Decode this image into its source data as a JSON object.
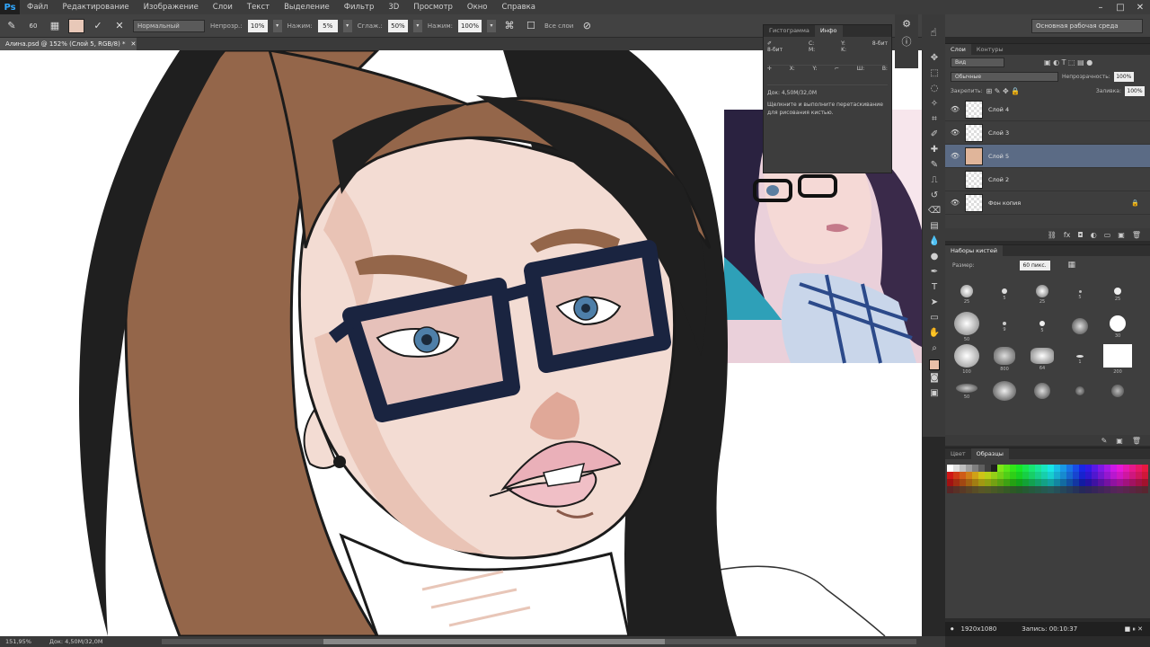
{
  "menubar": {
    "logo": "Ps",
    "items": [
      "Файл",
      "Редактирование",
      "Изображение",
      "Слои",
      "Текст",
      "Выделение",
      "Фильтр",
      "3D",
      "Просмотр",
      "Окно",
      "Справка"
    ],
    "minimize": "–",
    "maximize": "□",
    "close": "✕"
  },
  "options": {
    "brush_size": "60",
    "mode": "Нормальный",
    "opacity_label": "Непрозр.:",
    "opacity": "10%",
    "flow_label": "Нажим:",
    "flow": "5%",
    "smooth_label": "Сглаж.:",
    "smooth": "50%",
    "strength_label": "Нажим:",
    "strength": "100%",
    "sample_label": "Все слои",
    "workspace": "Основная рабочая среда"
  },
  "document": {
    "tab_title": "Алина.psd @ 152% (Слой 5, RGB/8) *",
    "zoom": "151,95%",
    "doc_size": "Док: 4,50M/32,0M"
  },
  "info_panel": {
    "tabs": [
      "Гистограмма",
      "Инфо"
    ],
    "c_label": "C:",
    "m_label": "M:",
    "y_label": "Y:",
    "k_label": "K:",
    "bit_left": "8-бит",
    "bit_right": "8-бит",
    "x_label": "X:",
    "y2_label": "Y:",
    "w_label": "Ш:",
    "h_label": "В:",
    "doc": "Док: 4,50M/32,0M",
    "hint": "Щелкните и выполните перетаскивание для рисования кистью."
  },
  "layers": {
    "tabs": [
      "Слои",
      "Контуры"
    ],
    "filter": "Вид",
    "blend_mode": "Обычные",
    "opacity_label": "Непрозрачность:",
    "opacity": "100%",
    "lock_label": "Закрепить:",
    "fill_label": "Заливка:",
    "fill": "100%",
    "items": [
      {
        "name": "Слой 4",
        "selected": false,
        "visible": true
      },
      {
        "name": "Слой 3",
        "selected": false,
        "visible": true
      },
      {
        "name": "Слой 5",
        "selected": true,
        "visible": true
      },
      {
        "name": "Слой 2",
        "selected": false,
        "visible": false
      },
      {
        "name": "Фон копия",
        "selected": false,
        "visible": true
      }
    ]
  },
  "brushes": {
    "tabs": [
      "Наборы кистей"
    ],
    "size_label": "Размер:",
    "size": "60 пикс.",
    "numbers": [
      "25",
      "5",
      "25",
      "5",
      "25",
      "50",
      "9",
      "5",
      "",
      "30",
      "100",
      "800",
      "64",
      "1",
      "200",
      "50",
      "",
      "",
      "",
      ""
    ]
  },
  "swatches": {
    "tabs": [
      "Цвет",
      "Образцы"
    ]
  },
  "right_status": {
    "size": "1920x1080",
    "label": "Запись: 00:10:37"
  },
  "colors": {
    "foreground": "#e9bfa8",
    "selected_layer": "#5b6b85"
  }
}
